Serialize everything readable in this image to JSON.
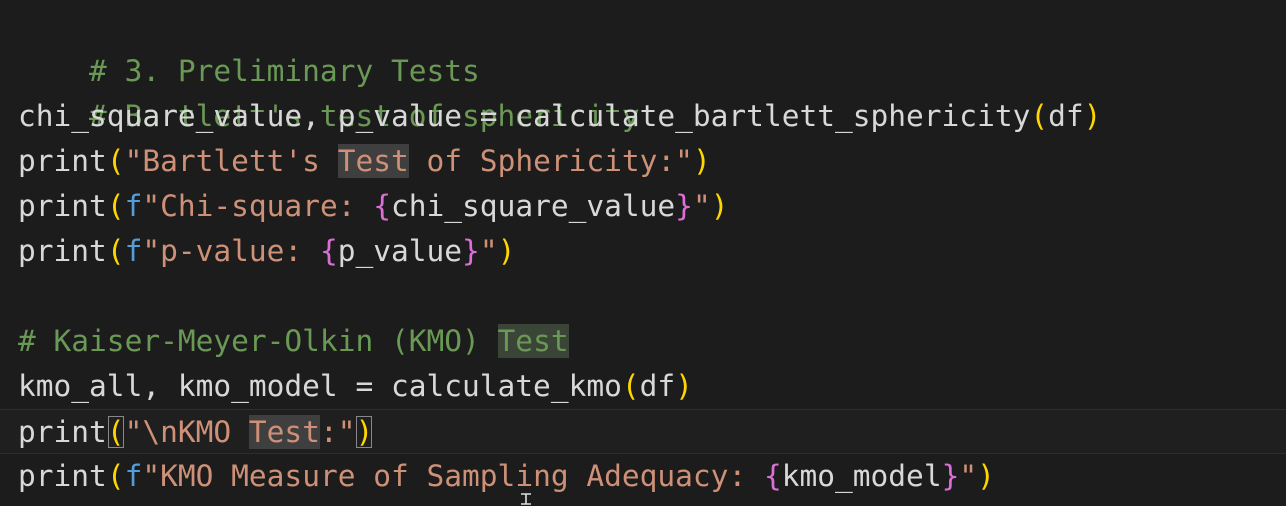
{
  "code": {
    "l1": {
      "comment": "# 3. Preliminary Tests"
    },
    "l2": {
      "comment": "# Bartlett's test of sphericity"
    },
    "l3": {
      "lhs": "chi_square_value, p_value = calculate_bartlett_sphericity",
      "open": "(",
      "arg": "df",
      "close": ")"
    },
    "l4": {
      "fn": "print",
      "open": "(",
      "str_a": "\"Bartlett's ",
      "str_hl": "Test",
      "str_b": " of Sphericity:\"",
      "close": ")"
    },
    "l5": {
      "fn": "print",
      "open": "(",
      "f": "f",
      "str_a": "\"Chi-square: ",
      "brace_o": "{",
      "var": "chi_square_value",
      "brace_c": "}",
      "str_b": "\"",
      "close": ")"
    },
    "l6": {
      "fn": "print",
      "open": "(",
      "f": "f",
      "str_a": "\"p-value: ",
      "brace_o": "{",
      "var": "p_value",
      "brace_c": "}",
      "str_b": "\"",
      "close": ")"
    },
    "l8": {
      "comment_a": "# Kaiser-Meyer-Olkin (KMO) ",
      "comment_hl": "Test"
    },
    "l9": {
      "lhs": "kmo_all, kmo_model = calculate_kmo",
      "open": "(",
      "arg": "df",
      "close": ")"
    },
    "l10": {
      "fn": "print",
      "open": "(",
      "str_a": "\"\\nKMO ",
      "str_hl": "Test",
      "str_b": ":\"",
      "close": ")"
    },
    "l11": {
      "fn": "print",
      "open": "(",
      "f": "f",
      "str_a": "\"KMO Measure of Sampling Adequacy: ",
      "brace_o": "{",
      "var": "kmo_model",
      "brace_c": "}",
      "str_b": "\"",
      "close": ")"
    }
  },
  "colors": {
    "background": "#1c1c1c",
    "comment": "#6a9955",
    "string": "#ce9178",
    "paren": "#ffd700",
    "fstring_prefix": "#569cd6",
    "brace": "#da70d6"
  }
}
